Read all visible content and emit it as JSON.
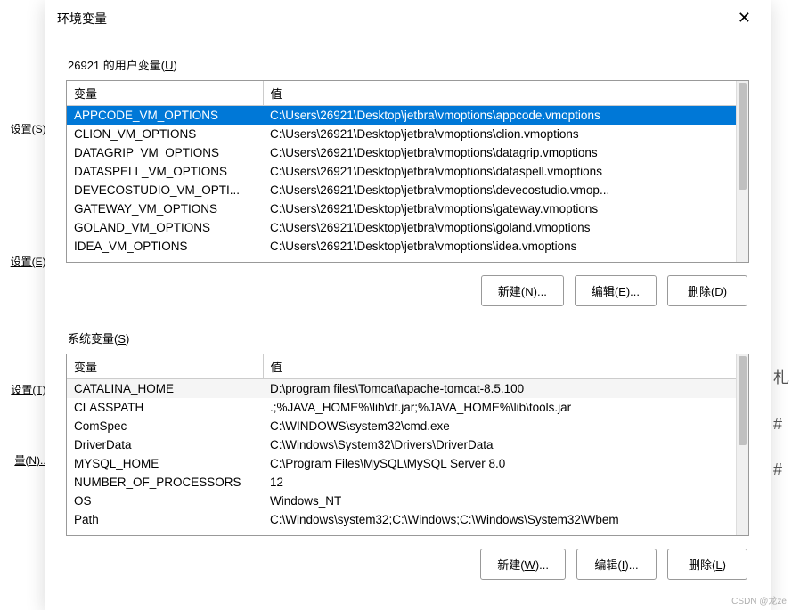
{
  "bg_left": {
    "items": [
      "设置(S).",
      "设置(E).",
      "设置(T).",
      "量(N)..."
    ]
  },
  "bg_right": {
    "items": [
      "札",
      "#",
      "#"
    ]
  },
  "dialog": {
    "title": "环境变量",
    "close_label": "✕"
  },
  "user_section": {
    "label_prefix": "26921 的用户变量(",
    "label_u": "U",
    "label_suffix": ")",
    "col_var": "变量",
    "col_val": "值",
    "rows": [
      {
        "var": "APPCODE_VM_OPTIONS",
        "val": "C:\\Users\\26921\\Desktop\\jetbra\\vmoptions\\appcode.vmoptions",
        "selected": true
      },
      {
        "var": "CLION_VM_OPTIONS",
        "val": "C:\\Users\\26921\\Desktop\\jetbra\\vmoptions\\clion.vmoptions"
      },
      {
        "var": "DATAGRIP_VM_OPTIONS",
        "val": "C:\\Users\\26921\\Desktop\\jetbra\\vmoptions\\datagrip.vmoptions"
      },
      {
        "var": "DATASPELL_VM_OPTIONS",
        "val": "C:\\Users\\26921\\Desktop\\jetbra\\vmoptions\\dataspell.vmoptions"
      },
      {
        "var": "DEVECOSTUDIO_VM_OPTI...",
        "val": "C:\\Users\\26921\\Desktop\\jetbra\\vmoptions\\devecostudio.vmop..."
      },
      {
        "var": "GATEWAY_VM_OPTIONS",
        "val": "C:\\Users\\26921\\Desktop\\jetbra\\vmoptions\\gateway.vmoptions"
      },
      {
        "var": "GOLAND_VM_OPTIONS",
        "val": "C:\\Users\\26921\\Desktop\\jetbra\\vmoptions\\goland.vmoptions"
      },
      {
        "var": "IDEA_VM_OPTIONS",
        "val": "C:\\Users\\26921\\Desktop\\jetbra\\vmoptions\\idea.vmoptions"
      }
    ],
    "buttons": {
      "new_pre": "新建(",
      "new_u": "N",
      "new_post": ")...",
      "edit_pre": "编辑(",
      "edit_u": "E",
      "edit_post": ")...",
      "del_pre": "删除(",
      "del_u": "D",
      "del_post": ")"
    }
  },
  "sys_section": {
    "label_prefix": "系统变量(",
    "label_u": "S",
    "label_suffix": ")",
    "col_var": "变量",
    "col_val": "值",
    "rows": [
      {
        "var": "CATALINA_HOME",
        "val": "D:\\program files\\Tomcat\\apache-tomcat-8.5.100",
        "alt": true
      },
      {
        "var": "CLASSPATH",
        "val": ".;%JAVA_HOME%\\lib\\dt.jar;%JAVA_HOME%\\lib\\tools.jar"
      },
      {
        "var": "ComSpec",
        "val": "C:\\WINDOWS\\system32\\cmd.exe"
      },
      {
        "var": "DriverData",
        "val": "C:\\Windows\\System32\\Drivers\\DriverData"
      },
      {
        "var": "MYSQL_HOME",
        "val": "C:\\Program Files\\MySQL\\MySQL Server 8.0"
      },
      {
        "var": "NUMBER_OF_PROCESSORS",
        "val": "12"
      },
      {
        "var": "OS",
        "val": "Windows_NT"
      },
      {
        "var": "Path",
        "val": "C:\\Windows\\system32;C:\\Windows;C:\\Windows\\System32\\Wbem"
      }
    ],
    "buttons": {
      "new_pre": "新建(",
      "new_u": "W",
      "new_post": ")...",
      "edit_pre": "编辑(",
      "edit_u": "I",
      "edit_post": ")...",
      "del_pre": "删除(",
      "del_u": "L",
      "del_post": ")"
    }
  },
  "watermark": "CSDN @龙ze"
}
